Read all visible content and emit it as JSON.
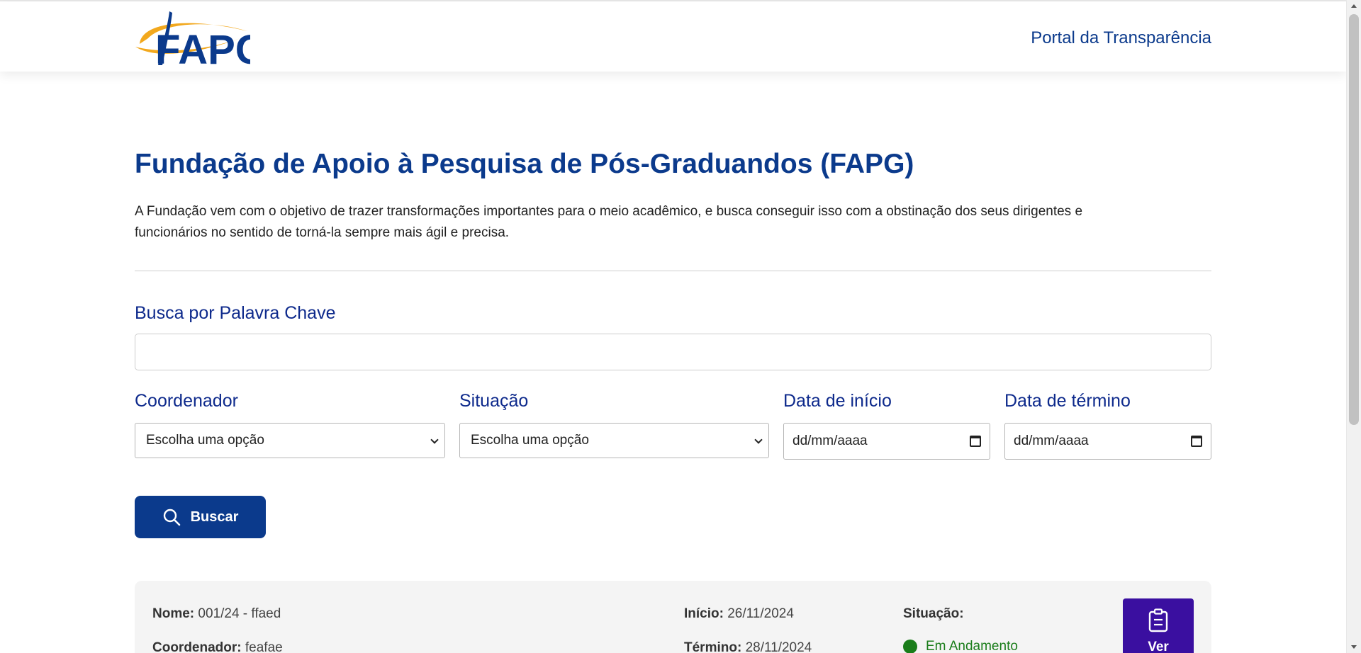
{
  "header": {
    "logo_text": "FAPG",
    "portal_link": "Portal da Transparência"
  },
  "page": {
    "title": "Fundação de Apoio à Pesquisa de Pós-Graduandos (FAPG)",
    "description": "A Fundação vem com o objetivo de trazer transformações importantes para o meio acadêmico, e busca conseguir isso com a obstinação dos seus dirigentes e funcionários no sentido de torná-la sempre mais ágil e precisa."
  },
  "filters": {
    "keyword_label": "Busca por Palavra Chave",
    "keyword_value": "",
    "coordinator_label": "Coordenador",
    "coordinator_value": "Escolha uma opção",
    "status_label": "Situação",
    "status_value": "Escolha uma opção",
    "start_label": "Data de início",
    "start_placeholder": "dd/mm/aaaa",
    "end_label": "Data de término",
    "end_placeholder": "dd/mm/aaaa",
    "search_button": "Buscar"
  },
  "results": [
    {
      "name_label": "Nome:",
      "name_value": "001/24 - ffaed",
      "coordinator_label": "Coordenador:",
      "coordinator_value": "feafae",
      "start_label": "Início:",
      "start_value": "26/11/2024",
      "end_label": "Término:",
      "end_value": "28/11/2024",
      "status_label": "Situação:",
      "status_value": "Em Andamento",
      "view_button": "Ver"
    }
  ],
  "colors": {
    "primary": "#0b3a8c",
    "label": "#0e2a8c",
    "status_green": "#1a7d1a",
    "view_button": "#3a0fa0",
    "logo_gold": "#f2a81d"
  },
  "icons": {
    "search": "search-icon",
    "clipboard": "clipboard-icon",
    "calendar": "calendar-icon",
    "chevron": "chevron-down-icon"
  }
}
